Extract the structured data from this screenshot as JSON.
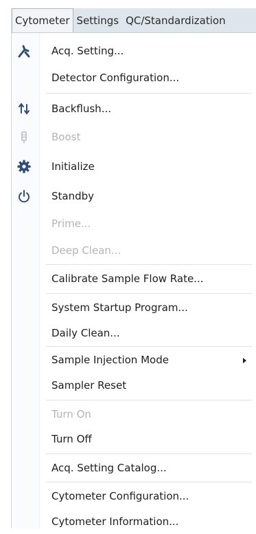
{
  "menubar": {
    "items": [
      "Cytometer",
      "Settings",
      "QC/Standardization"
    ]
  },
  "menu": {
    "items": [
      {
        "label": "Acq. Setting...",
        "icon": "wrench-tool-icon",
        "enabled": true
      },
      {
        "label": "Detector Configuration...",
        "icon": "",
        "enabled": true
      },
      {
        "label": "Backflush...",
        "icon": "backflush-icon",
        "enabled": true
      },
      {
        "label": "Boost",
        "icon": "boost-icon",
        "enabled": false
      },
      {
        "label": "Initialize",
        "icon": "gear-icon",
        "enabled": true
      },
      {
        "label": "Standby",
        "icon": "power-icon",
        "enabled": true
      },
      {
        "label": "Prime...",
        "icon": "",
        "enabled": false
      },
      {
        "label": "Deep Clean...",
        "icon": "",
        "enabled": false
      },
      {
        "label": "Calibrate Sample Flow Rate...",
        "icon": "",
        "enabled": true
      },
      {
        "label": "System Startup Program...",
        "icon": "",
        "enabled": true
      },
      {
        "label": "Daily Clean...",
        "icon": "",
        "enabled": true
      },
      {
        "label": "Sample Injection Mode",
        "icon": "",
        "enabled": true,
        "submenu": true
      },
      {
        "label": "Sampler Reset",
        "icon": "",
        "enabled": true
      },
      {
        "label": "Turn On",
        "icon": "",
        "enabled": false
      },
      {
        "label": "Turn Off",
        "icon": "",
        "enabled": true
      },
      {
        "label": "Acq. Setting Catalog...",
        "icon": "",
        "enabled": true
      },
      {
        "label": "Cytometer Configuration...",
        "icon": "",
        "enabled": true
      },
      {
        "label": "Cytometer Information...",
        "icon": "",
        "enabled": true
      }
    ]
  },
  "colors": {
    "menubar_bg": "#dfe5ec",
    "icon_blue": "#2f4f7a",
    "disabled_text": "#b4b4b4"
  }
}
